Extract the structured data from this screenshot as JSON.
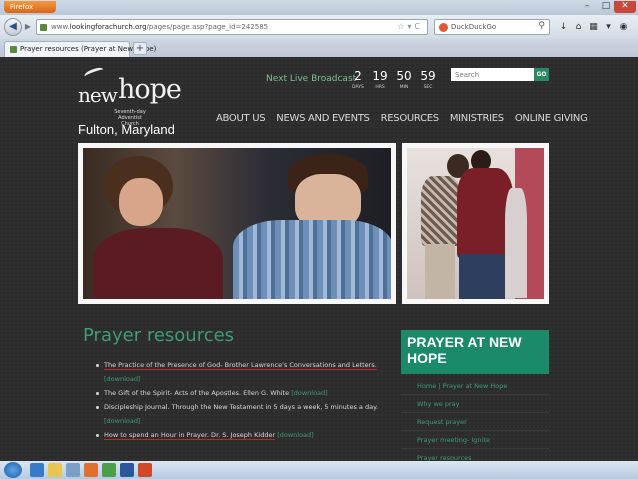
{
  "browser": {
    "app_button": "Firefox",
    "url_prefix": "www.",
    "url_host": "lookingforachurch.org",
    "url_path": "/pages/page.asp?page_id=242585",
    "search_engine": "DuckDuckGo",
    "tab_title": "Prayer resources (Prayer at New Hope)",
    "new_tab_label": "+"
  },
  "site": {
    "logo_new": "new",
    "logo_hope": "hope",
    "logo_sub": "Seventh-day Adventist Church",
    "location": "Fulton, Maryland",
    "next_broadcast_label": "Next Live Broadcast",
    "countdown": [
      {
        "num": "2",
        "label": "DAYS"
      },
      {
        "num": "19",
        "label": "HRS"
      },
      {
        "num": "50",
        "label": "MIN"
      },
      {
        "num": "59",
        "label": "SEC"
      }
    ],
    "search_placeholder": "Search",
    "search_go": "GO",
    "nav": [
      "ABOUT US",
      "NEWS AND EVENTS",
      "RESOURCES",
      "MINISTRIES",
      "ONLINE GIVING"
    ]
  },
  "main": {
    "title": "Prayer resources",
    "items": [
      {
        "text": "The Practice of the Presence of God- Brother Lawrence's Conversations and Letters.",
        "link": "[download]"
      },
      {
        "text": "The Gift of the Spirit- Acts of the Apostles. Ellen G. White",
        "link": "[download]"
      },
      {
        "text": "Discipleship Journal. Through the New Testament in 5 days a week, 5 minutes a day.",
        "link": "[download]"
      },
      {
        "text": "How to spend an Hour in Prayer. Dr. S. Joseph Kidder",
        "link": "[download]"
      }
    ]
  },
  "sidebar": {
    "heading": "PRAYER AT NEW HOPE",
    "links": [
      "Home | Prayer at New Hope",
      "Why we pray",
      "Request prayer",
      "Prayer meeting- Ignite",
      "Prayer resources"
    ]
  },
  "colors": {
    "accent": "#3d9c74",
    "sidebar_header": "#1a8a6a",
    "underline": "#c0262c",
    "page_bg": "#2c2c2c"
  }
}
